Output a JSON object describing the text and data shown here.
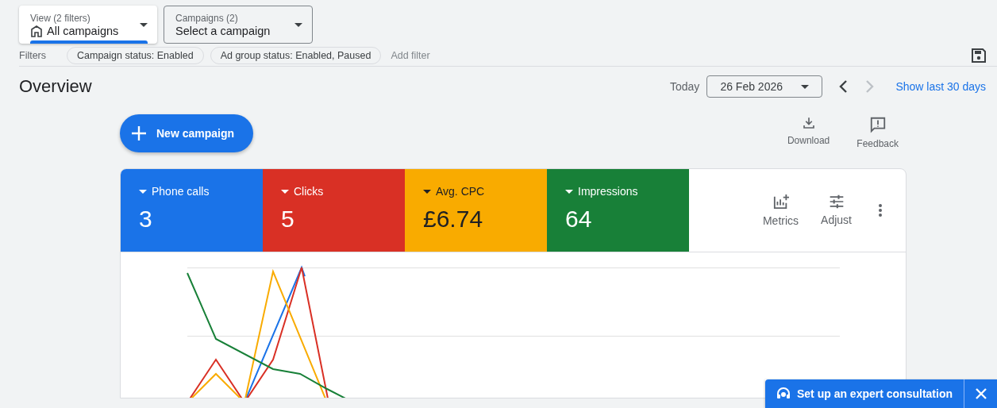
{
  "view_selector": {
    "label": "View (2 filters)",
    "value": "All campaigns"
  },
  "campaign_selector": {
    "label": "Campaigns (2)",
    "value": "Select a campaign"
  },
  "filters": {
    "label": "Filters",
    "chips": [
      "Campaign status: Enabled",
      "Ad group status: Enabled, Paused"
    ],
    "add_filter": "Add filter"
  },
  "header": {
    "title": "Overview",
    "date_label": "Today",
    "date": "26 Feb 2026",
    "prev_disabled": false,
    "next_disabled": true,
    "show_last": "Show last 30 days"
  },
  "toolbar": {
    "new_campaign": "New campaign",
    "actions": [
      {
        "kind": "download",
        "label": "Download"
      },
      {
        "kind": "feedback",
        "label": "Feedback"
      }
    ]
  },
  "metrics": [
    {
      "label": "Phone calls",
      "value": "3",
      "selected": true,
      "color": "#1a73e8"
    },
    {
      "label": "Clicks",
      "value": "5",
      "selected": true,
      "color": "#d93025"
    },
    {
      "label": "Avg. CPC",
      "value": "£6.74",
      "selected": true,
      "color": "#f9ab00"
    },
    {
      "label": "Impressions",
      "value": "64",
      "selected": true,
      "color": "#188038"
    }
  ],
  "card_actions": [
    {
      "kind": "metrics",
      "label": "Metrics"
    },
    {
      "kind": "adjust",
      "label": "Adjust"
    }
  ],
  "consultation": {
    "label": "Set up an expert consultation"
  }
}
